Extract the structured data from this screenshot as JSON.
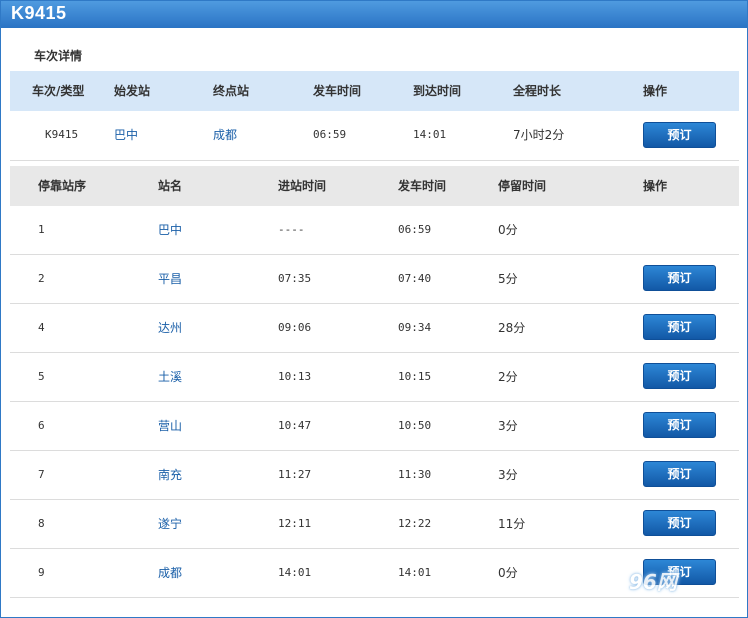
{
  "train_no": "K9415",
  "section_title": "车次详情",
  "train_header": [
    "车次/类型",
    "始发站",
    "终点站",
    "发车时间",
    "到达时间",
    "全程时长",
    "操作"
  ],
  "train": {
    "number": "K9415",
    "origin": "巴中",
    "destination": "成都",
    "depart": "06:59",
    "arrive": "14:01",
    "duration": "7小时2分",
    "book_label": "预订"
  },
  "stops_header": [
    "停靠站序",
    "站名",
    "进站时间",
    "发车时间",
    "停留时间",
    "操作"
  ],
  "stops": [
    {
      "seq": "1",
      "station": "巴中",
      "arrive": "----",
      "depart": "06:59",
      "stay": "0分",
      "book": ""
    },
    {
      "seq": "2",
      "station": "平昌",
      "arrive": "07:35",
      "depart": "07:40",
      "stay": "5分",
      "book": "预订"
    },
    {
      "seq": "4",
      "station": "达州",
      "arrive": "09:06",
      "depart": "09:34",
      "stay": "28分",
      "book": "预订"
    },
    {
      "seq": "5",
      "station": "土溪",
      "arrive": "10:13",
      "depart": "10:15",
      "stay": "2分",
      "book": "预订"
    },
    {
      "seq": "6",
      "station": "营山",
      "arrive": "10:47",
      "depart": "10:50",
      "stay": "3分",
      "book": "预订"
    },
    {
      "seq": "7",
      "station": "南充",
      "arrive": "11:27",
      "depart": "11:30",
      "stay": "3分",
      "book": "预订"
    },
    {
      "seq": "8",
      "station": "遂宁",
      "arrive": "12:11",
      "depart": "12:22",
      "stay": "11分",
      "book": "预订"
    },
    {
      "seq": "9",
      "station": "成都",
      "arrive": "14:01",
      "depart": "14:01",
      "stay": "0分",
      "book": "预订"
    }
  ],
  "watermark": "96网"
}
